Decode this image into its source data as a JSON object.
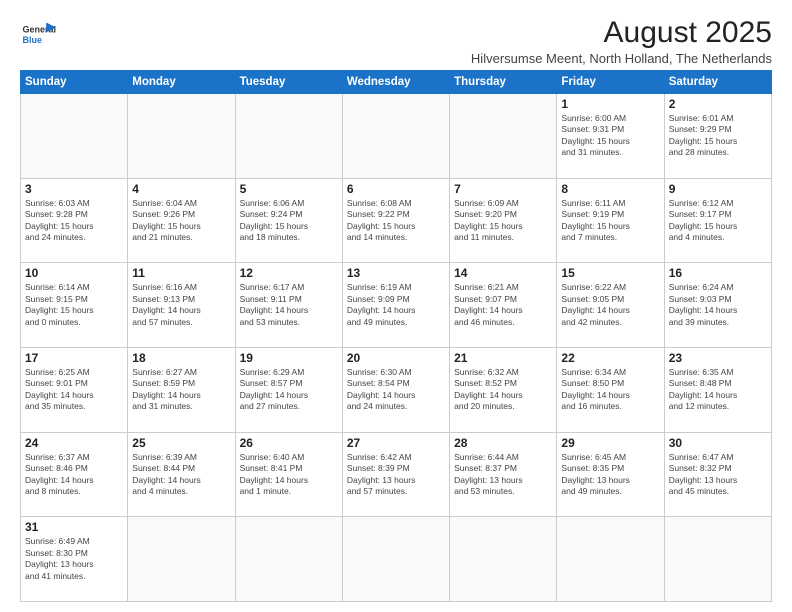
{
  "header": {
    "logo_line1": "General",
    "logo_line2": "Blue",
    "month_year": "August 2025",
    "location": "Hilversumse Meent, North Holland, The Netherlands"
  },
  "weekdays": [
    "Sunday",
    "Monday",
    "Tuesday",
    "Wednesday",
    "Thursday",
    "Friday",
    "Saturday"
  ],
  "weeks": [
    [
      {
        "day": "",
        "info": ""
      },
      {
        "day": "",
        "info": ""
      },
      {
        "day": "",
        "info": ""
      },
      {
        "day": "",
        "info": ""
      },
      {
        "day": "",
        "info": ""
      },
      {
        "day": "1",
        "info": "Sunrise: 6:00 AM\nSunset: 9:31 PM\nDaylight: 15 hours\nand 31 minutes."
      },
      {
        "day": "2",
        "info": "Sunrise: 6:01 AM\nSunset: 9:29 PM\nDaylight: 15 hours\nand 28 minutes."
      }
    ],
    [
      {
        "day": "3",
        "info": "Sunrise: 6:03 AM\nSunset: 9:28 PM\nDaylight: 15 hours\nand 24 minutes."
      },
      {
        "day": "4",
        "info": "Sunrise: 6:04 AM\nSunset: 9:26 PM\nDaylight: 15 hours\nand 21 minutes."
      },
      {
        "day": "5",
        "info": "Sunrise: 6:06 AM\nSunset: 9:24 PM\nDaylight: 15 hours\nand 18 minutes."
      },
      {
        "day": "6",
        "info": "Sunrise: 6:08 AM\nSunset: 9:22 PM\nDaylight: 15 hours\nand 14 minutes."
      },
      {
        "day": "7",
        "info": "Sunrise: 6:09 AM\nSunset: 9:20 PM\nDaylight: 15 hours\nand 11 minutes."
      },
      {
        "day": "8",
        "info": "Sunrise: 6:11 AM\nSunset: 9:19 PM\nDaylight: 15 hours\nand 7 minutes."
      },
      {
        "day": "9",
        "info": "Sunrise: 6:12 AM\nSunset: 9:17 PM\nDaylight: 15 hours\nand 4 minutes."
      }
    ],
    [
      {
        "day": "10",
        "info": "Sunrise: 6:14 AM\nSunset: 9:15 PM\nDaylight: 15 hours\nand 0 minutes."
      },
      {
        "day": "11",
        "info": "Sunrise: 6:16 AM\nSunset: 9:13 PM\nDaylight: 14 hours\nand 57 minutes."
      },
      {
        "day": "12",
        "info": "Sunrise: 6:17 AM\nSunset: 9:11 PM\nDaylight: 14 hours\nand 53 minutes."
      },
      {
        "day": "13",
        "info": "Sunrise: 6:19 AM\nSunset: 9:09 PM\nDaylight: 14 hours\nand 49 minutes."
      },
      {
        "day": "14",
        "info": "Sunrise: 6:21 AM\nSunset: 9:07 PM\nDaylight: 14 hours\nand 46 minutes."
      },
      {
        "day": "15",
        "info": "Sunrise: 6:22 AM\nSunset: 9:05 PM\nDaylight: 14 hours\nand 42 minutes."
      },
      {
        "day": "16",
        "info": "Sunrise: 6:24 AM\nSunset: 9:03 PM\nDaylight: 14 hours\nand 39 minutes."
      }
    ],
    [
      {
        "day": "17",
        "info": "Sunrise: 6:25 AM\nSunset: 9:01 PM\nDaylight: 14 hours\nand 35 minutes."
      },
      {
        "day": "18",
        "info": "Sunrise: 6:27 AM\nSunset: 8:59 PM\nDaylight: 14 hours\nand 31 minutes."
      },
      {
        "day": "19",
        "info": "Sunrise: 6:29 AM\nSunset: 8:57 PM\nDaylight: 14 hours\nand 27 minutes."
      },
      {
        "day": "20",
        "info": "Sunrise: 6:30 AM\nSunset: 8:54 PM\nDaylight: 14 hours\nand 24 minutes."
      },
      {
        "day": "21",
        "info": "Sunrise: 6:32 AM\nSunset: 8:52 PM\nDaylight: 14 hours\nand 20 minutes."
      },
      {
        "day": "22",
        "info": "Sunrise: 6:34 AM\nSunset: 8:50 PM\nDaylight: 14 hours\nand 16 minutes."
      },
      {
        "day": "23",
        "info": "Sunrise: 6:35 AM\nSunset: 8:48 PM\nDaylight: 14 hours\nand 12 minutes."
      }
    ],
    [
      {
        "day": "24",
        "info": "Sunrise: 6:37 AM\nSunset: 8:46 PM\nDaylight: 14 hours\nand 8 minutes."
      },
      {
        "day": "25",
        "info": "Sunrise: 6:39 AM\nSunset: 8:44 PM\nDaylight: 14 hours\nand 4 minutes."
      },
      {
        "day": "26",
        "info": "Sunrise: 6:40 AM\nSunset: 8:41 PM\nDaylight: 14 hours\nand 1 minute."
      },
      {
        "day": "27",
        "info": "Sunrise: 6:42 AM\nSunset: 8:39 PM\nDaylight: 13 hours\nand 57 minutes."
      },
      {
        "day": "28",
        "info": "Sunrise: 6:44 AM\nSunset: 8:37 PM\nDaylight: 13 hours\nand 53 minutes."
      },
      {
        "day": "29",
        "info": "Sunrise: 6:45 AM\nSunset: 8:35 PM\nDaylight: 13 hours\nand 49 minutes."
      },
      {
        "day": "30",
        "info": "Sunrise: 6:47 AM\nSunset: 8:32 PM\nDaylight: 13 hours\nand 45 minutes."
      }
    ],
    [
      {
        "day": "31",
        "info": "Sunrise: 6:49 AM\nSunset: 8:30 PM\nDaylight: 13 hours\nand 41 minutes."
      },
      {
        "day": "",
        "info": ""
      },
      {
        "day": "",
        "info": ""
      },
      {
        "day": "",
        "info": ""
      },
      {
        "day": "",
        "info": ""
      },
      {
        "day": "",
        "info": ""
      },
      {
        "day": "",
        "info": ""
      }
    ]
  ]
}
